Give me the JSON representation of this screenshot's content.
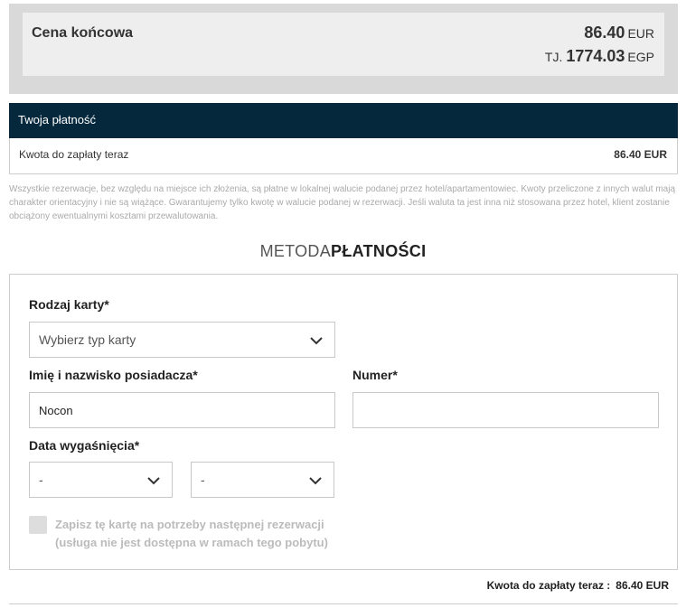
{
  "summary": {
    "label": "Cena końcowa",
    "amount": "86.40",
    "currency": "EUR",
    "converted_prefix": "TJ.",
    "converted_amount": "1774.03",
    "converted_currency": "EGP"
  },
  "payment": {
    "header": "Twoja płatność",
    "due_label": "Kwota do zapłaty teraz",
    "due_value": "86.40 EUR",
    "disclaimer": "Wszystkie rezerwacje, bez względu na miejsce ich złożenia, są płatne w lokalnej walucie podanej przez hotel/apartamentowiec. Kwoty przeliczone z innych walut mają charakter orientacyjny i nie są wiążące. Gwarantujemy tylko kwotę w walucie podanej w rezerwacji. Jeśli waluta ta jest inna niż stosowana przez hotel, klient zostanie obciążony ewentualnymi kosztami przewalutowania."
  },
  "method": {
    "title_light": "METODA",
    "title_bold": "PŁATNOŚCI"
  },
  "form": {
    "card_type_label": "Rodzaj karty*",
    "card_type_value": "Wybierz typ karty",
    "holder_label": "Imię i nazwisko posiadacza*",
    "holder_value": "Nocon",
    "number_label": "Numer*",
    "number_value": "",
    "expiry_label": "Data wygaśnięcia*",
    "expiry_month_value": "-",
    "expiry_year_value": "-",
    "save_card_line1": "Zapisz tę kartę na potrzeby następnej rezerwacji",
    "save_card_line2": "(usługa nie jest dostępna w ramach tego pobytu)"
  },
  "footer": {
    "due_label": "Kwota do zapłaty teraz :",
    "due_value": "86.40 EUR"
  },
  "icons": {
    "dropdown": "chevron-down-icon"
  },
  "colors": {
    "header_bg": "#06283d",
    "summary_outer": "#d9d9d9",
    "summary_inner": "#eeeeee"
  }
}
